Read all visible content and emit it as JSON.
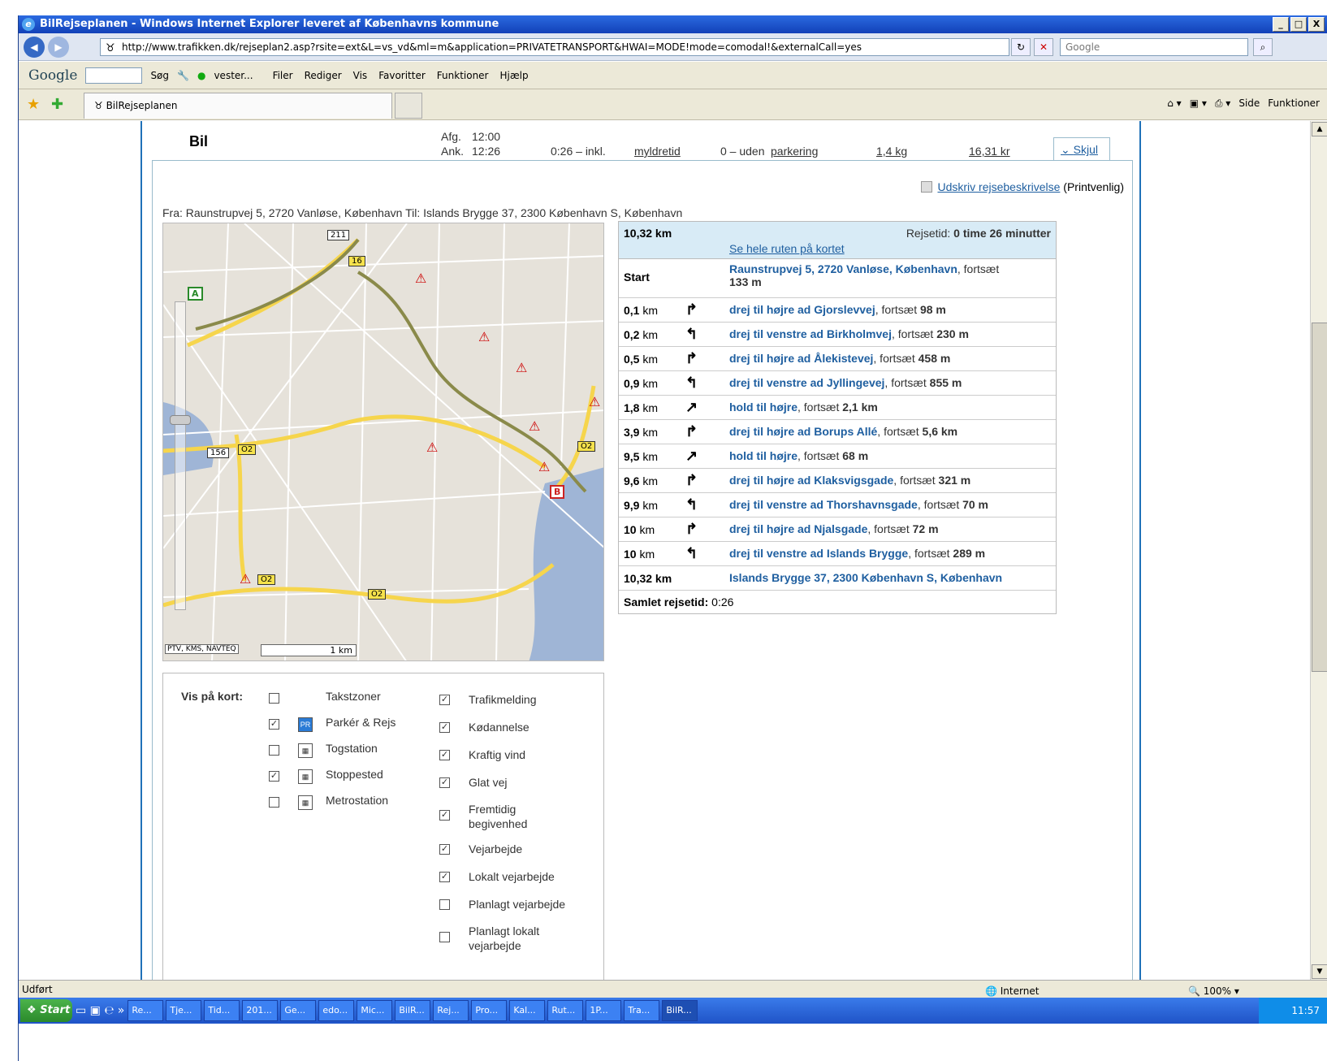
{
  "window": {
    "title": "BilRejseplanen - Windows Internet Explorer leveret af Københavns kommune",
    "buttons": [
      "_",
      "□",
      "X"
    ]
  },
  "address_bar": {
    "url": "http://www.trafikken.dk/rejseplan2.asp?rsite=ext&L=vs_vd&ml=m&application=PRIVATETRANSPORT&HWAI=MODE!mode=comodal!&externalCall=yes",
    "search_placeholder": "Google"
  },
  "toolbar": {
    "google": "Google",
    "search": "Søg",
    "vester": "vester...",
    "menu": [
      "Filer",
      "Rediger",
      "Vis",
      "Favoritter",
      "Funktioner",
      "Hjælp"
    ]
  },
  "favorites_bar": {
    "tab_title": "BilRejseplanen",
    "side": "Side",
    "funktioner": "Funktioner"
  },
  "route_header": {
    "mode": "Bil",
    "depart_label": "Afg.",
    "depart_time": "12:00",
    "arrive_label": "Ank.",
    "arrive_time": "12:26",
    "duration": "0:26 – inkl.",
    "duration_link": "myldretid",
    "parking": "0 – uden",
    "parking_link": "parkering",
    "co2": "1,4 kg",
    "cost": "16,31 kr",
    "hide": "Skjul"
  },
  "print": {
    "link": "Udskriv rejsebeskrivelse",
    "suffix": "(Printvenlig)"
  },
  "from_to": "Fra: Raunstrupvej 5, 2720 Vanløse, København Til: Islands Brygge 37, 2300 København S, København",
  "map": {
    "copyright": "PTV, KMS, NAVTEQ",
    "scale": "1 km",
    "road_labels": [
      "211",
      "16",
      "156",
      "O2",
      "O2",
      "O2",
      "O2"
    ],
    "markers": [
      "A",
      "B"
    ]
  },
  "directions": {
    "total_distance": "10,32 km",
    "travel_time_label": "Rejsetid:",
    "travel_time": "0 time 26 minutter",
    "see_route": "Se hele ruten på kortet",
    "start_label": "Start",
    "start_address": "Raunstrupvej 5, 2720 Vanløse, København",
    "start_continue": ", fortsæt",
    "start_meters": "133 m",
    "steps": [
      {
        "dist": "0,1",
        "unit": "km",
        "turn": "↱",
        "link": "drej til højre ad Gjorslevvej",
        "rest": ", fortsæt ",
        "len": "98 m"
      },
      {
        "dist": "0,2",
        "unit": "km",
        "turn": "↰",
        "link": "drej til venstre ad Birkholmvej",
        "rest": ", fortsæt ",
        "len": "230 m"
      },
      {
        "dist": "0,5",
        "unit": "km",
        "turn": "↱",
        "link": "drej til højre ad Ålekistevej",
        "rest": ", fortsæt ",
        "len": "458 m"
      },
      {
        "dist": "0,9",
        "unit": "km",
        "turn": "↰",
        "link": "drej til venstre ad Jyllingevej",
        "rest": ", fortsæt ",
        "len": "855 m"
      },
      {
        "dist": "1,8",
        "unit": "km",
        "turn": "↗",
        "link": "hold til højre",
        "rest": ", fortsæt ",
        "len": "2,1 km"
      },
      {
        "dist": "3,9",
        "unit": "km",
        "turn": "↱",
        "link": "drej til højre ad Borups Allé",
        "rest": ", fortsæt ",
        "len": "5,6 km"
      },
      {
        "dist": "9,5",
        "unit": "km",
        "turn": "↗",
        "link": "hold til højre",
        "rest": ", fortsæt ",
        "len": "68 m"
      },
      {
        "dist": "9,6",
        "unit": "km",
        "turn": "↱",
        "link": "drej til højre ad Klaksvigsgade",
        "rest": ", fortsæt ",
        "len": "321 m"
      },
      {
        "dist": "9,9",
        "unit": "km",
        "turn": "↰",
        "link": "drej til venstre ad Thorshavnsgade",
        "rest": ", fortsæt ",
        "len": "70 m"
      },
      {
        "dist": "10",
        "unit": "km",
        "turn": "↱",
        "link": "drej til højre ad Njalsgade",
        "rest": ", fortsæt ",
        "len": "72 m"
      },
      {
        "dist": "10",
        "unit": "km",
        "turn": "↰",
        "link": "drej til venstre ad Islands Brygge",
        "rest": ", fortsæt ",
        "len": "289 m"
      }
    ],
    "end_distance": "10,32 km",
    "end_address": "Islands Brygge 37, 2300 København S, København",
    "total_label": "Samlet rejsetid:",
    "total_time": "0:26"
  },
  "vis_paa_kort": {
    "label": "Vis på kort:",
    "left": [
      {
        "label": "Takstzoner",
        "checked": false,
        "icon": ""
      },
      {
        "label": "Parkér & Rejs",
        "checked": true,
        "icon": "PR"
      },
      {
        "label": "Togstation",
        "checked": false,
        "icon": "train-icon"
      },
      {
        "label": "Stoppested",
        "checked": true,
        "icon": "bus-icon"
      },
      {
        "label": "Metrostation",
        "checked": false,
        "icon": "metro-icon"
      }
    ],
    "right": [
      {
        "label": "Trafikmelding",
        "checked": true
      },
      {
        "label": "Kødannelse",
        "checked": true
      },
      {
        "label": "Kraftig vind",
        "checked": true
      },
      {
        "label": "Glat vej",
        "checked": true
      },
      {
        "label": "Fremtidig begivenhed",
        "checked": true
      },
      {
        "label": "Vejarbejde",
        "checked": true
      },
      {
        "label": "Lokalt vejarbejde",
        "checked": true
      },
      {
        "label": "Planlagt vejarbejde",
        "checked": false
      },
      {
        "label": "Planlagt lokalt vejarbejde",
        "checked": false
      }
    ]
  },
  "status_bar": {
    "text": "Udført",
    "zone": "Internet",
    "zoom": "100%"
  },
  "taskbar": {
    "start": "Start",
    "tasks": [
      "Re...",
      "Tje...",
      "Tid...",
      "201...",
      "Ge...",
      "edo...",
      "Mic...",
      "BilR...",
      "Rej...",
      "Pro...",
      "Kal...",
      "Rut...",
      "1P...",
      "Tra...",
      "BilR..."
    ],
    "clock": "11:57"
  }
}
